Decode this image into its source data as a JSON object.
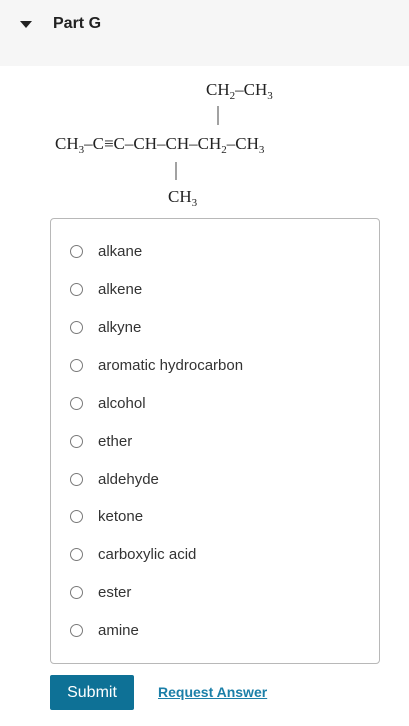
{
  "part": {
    "title": "Part G"
  },
  "molecule": {
    "top_group": {
      "a": "CH",
      "a_sub": "2",
      "dash": "–",
      "b": "CH",
      "b_sub": "3"
    },
    "main_chain": [
      {
        "text": "CH",
        "sub": "3"
      },
      {
        "text": "–C≡C–CH–CH–CH"
      },
      {
        "text": "",
        "sub": "2"
      },
      {
        "text": "–CH"
      },
      {
        "text": "",
        "sub": "3"
      }
    ],
    "bottom_group": {
      "a": "CH",
      "a_sub": "3"
    }
  },
  "options": [
    {
      "label": "alkane"
    },
    {
      "label": "alkene"
    },
    {
      "label": "alkyne"
    },
    {
      "label": "aromatic hydrocarbon"
    },
    {
      "label": "alcohol"
    },
    {
      "label": "ether"
    },
    {
      "label": "aldehyde"
    },
    {
      "label": "ketone"
    },
    {
      "label": "carboxylic acid"
    },
    {
      "label": "ester"
    },
    {
      "label": "amine"
    }
  ],
  "actions": {
    "submit_label": "Submit",
    "request_answer_label": "Request Answer"
  },
  "colors": {
    "header_bg": "#f6f6f6",
    "submit_bg": "#0e7196",
    "link": "#1b7fa8"
  }
}
